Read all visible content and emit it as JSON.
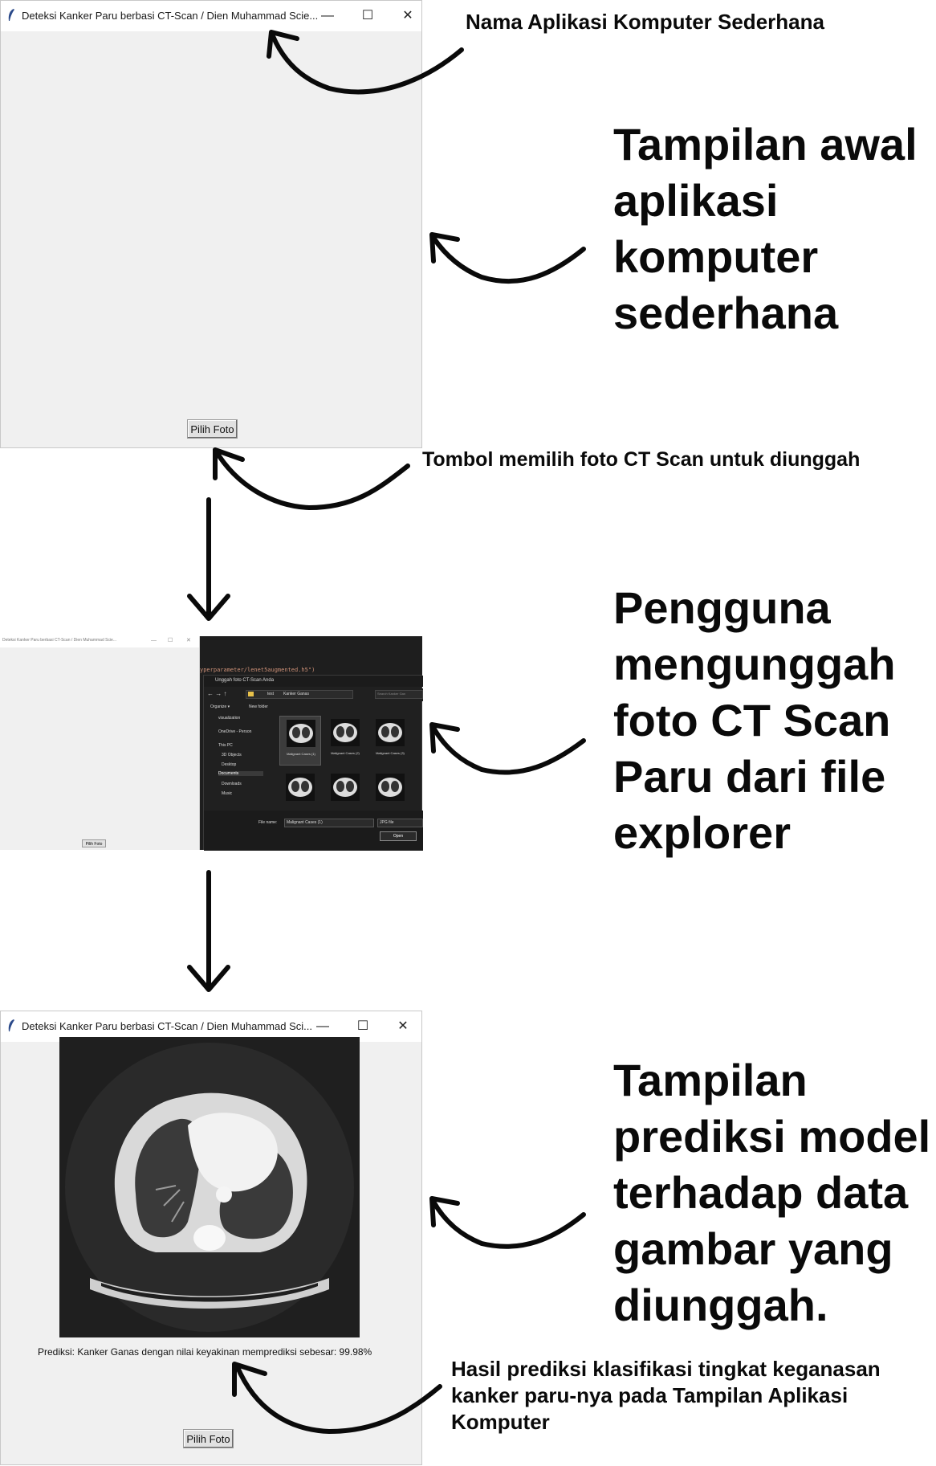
{
  "window": {
    "title_truncated": "Deteksi Kanker Paru berbasi CT-Scan / Dien Muhammad Scie...",
    "title_result": "Deteksi Kanker Paru berbasi CT-Scan / Dien Muhammad Sci...",
    "title_small": "Deteksi Kanker Paru berbasi CT-Scan / Dien Muhammad Scie...",
    "minimize": "—",
    "maximize": "☐",
    "close": "✕",
    "pick_photo_button": "Pilih Foto"
  },
  "annotations": {
    "app_name": "Nama Aplikasi Komputer Sederhana",
    "initial_view": "Tampilan awal aplikasi komputer sederhana",
    "button_desc": "Tombol memilih foto CT Scan untuk diunggah",
    "upload_desc": "Pengguna mengunggah foto CT Scan Paru dari file explorer",
    "prediction_view": "Tampilan prediksi model terhadap data gambar yang diunggah.",
    "result_desc": "Hasil prediksi klasifikasi tingkat keganasan kanker paru-nya pada Tampilan Aplikasi Komputer"
  },
  "file_dialog": {
    "code_line": "yperparameter/lenet5augmented.h5\")",
    "title": "Unggah foto CT-Scan Anda",
    "breadcrumb_1": "test",
    "breadcrumb_2": "Kanker Ganas",
    "search_placeholder": "Search Kanker Gan",
    "organize": "Organize ▾",
    "new_folder": "New folder",
    "nav_items": [
      "visualization",
      "OneDrive - Person",
      "This PC",
      "3D Objects",
      "Desktop",
      "Documents",
      "Downloads",
      "Music"
    ],
    "thumb_labels": [
      "Malignant Cases (1)",
      "Malignant Cases (2)",
      "Malignant Cases (3)"
    ],
    "file_name_label": "File name:",
    "file_name_value": "Malignant Cases (1)",
    "file_type": "JPG file",
    "open_button": "Open"
  },
  "prediction": {
    "text": "Prediksi: Kanker Ganas dengan nilai keyakinan memprediksi sebesar: 99.98%"
  },
  "colors": {
    "window_bg": "#f0f0f0",
    "dark_bg": "#1e1e1e",
    "annotation_text": "#0a0a0a"
  }
}
